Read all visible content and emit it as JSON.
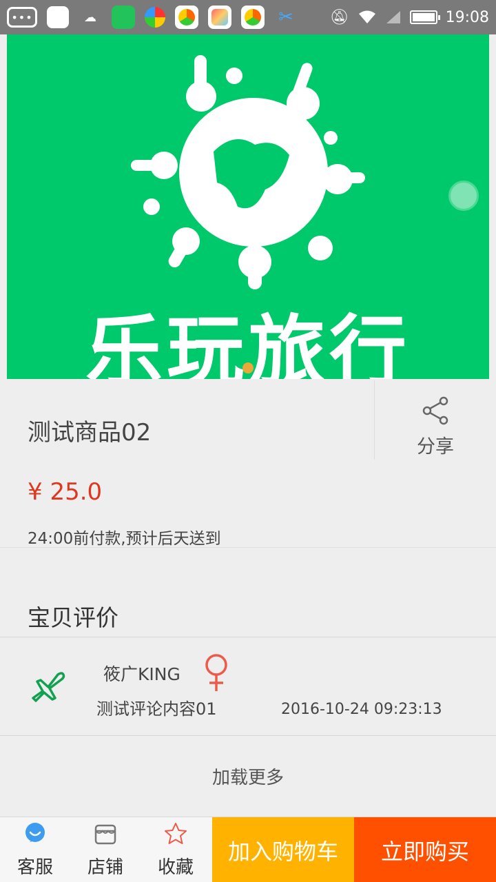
{
  "status_bar": {
    "time": "19:08",
    "icons": [
      "back-icon",
      "app-icon",
      "weather-icon",
      "store-icon",
      "browser-icon",
      "game-icon",
      "home-icon",
      "game-icon",
      "scissors-icon",
      "mute-icon",
      "wifi-icon",
      "signal-icon",
      "battery-icon"
    ]
  },
  "banner": {
    "text": "乐玩旅行",
    "background_color": "#00c96b",
    "page_indicator_count": 1
  },
  "product": {
    "title": "测试商品02",
    "share_label": "分享",
    "price": "¥ 25.0",
    "delivery_note": "24:00前付款,预计后天送到"
  },
  "reviews": {
    "section_title": "宝贝评价",
    "items": [
      {
        "avatar_icon": "plane-icon",
        "username": "筱广KING",
        "gender_icon": "female-icon",
        "content": "测试评论内容01",
        "time": "2016-10-24 09:23:13"
      }
    ],
    "load_more_label": "加载更多"
  },
  "bottom_bar": {
    "tabs": [
      {
        "label": "客服",
        "icon": "customer-service-icon"
      },
      {
        "label": "店铺",
        "icon": "store-icon"
      },
      {
        "label": "收藏",
        "icon": "star-icon"
      }
    ],
    "add_to_cart_label": "加入购物车",
    "buy_now_label": "立即购买",
    "colors": {
      "cart": "#ffb300",
      "buy": "#ff5000"
    }
  }
}
